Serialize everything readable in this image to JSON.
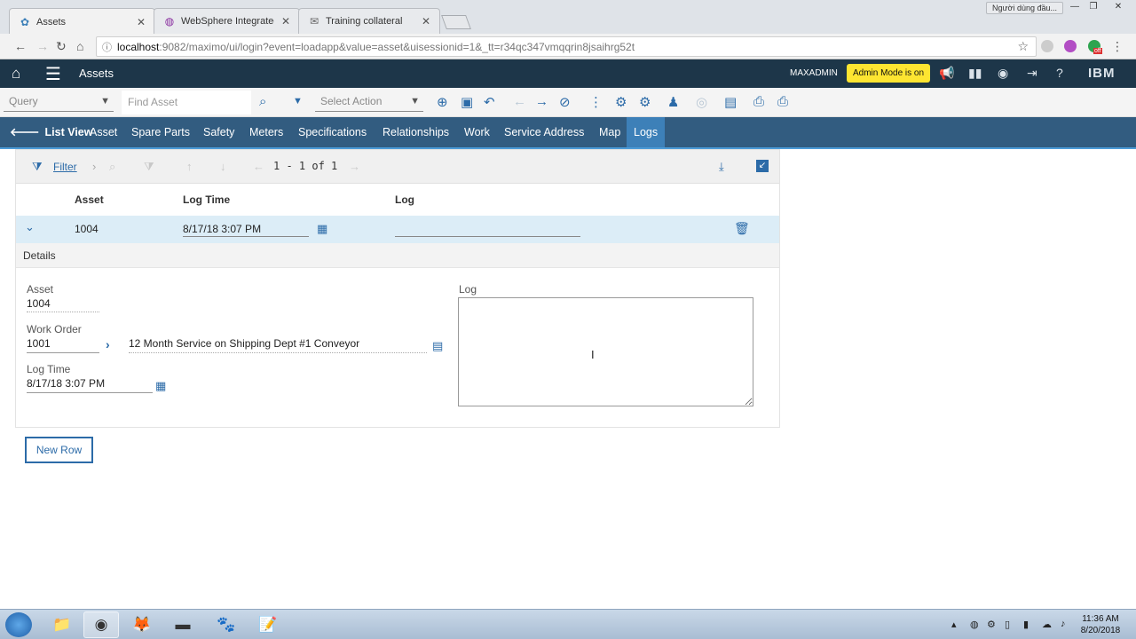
{
  "browser": {
    "tabs": [
      {
        "title": "Assets",
        "favicon": "asset-icon",
        "active": true
      },
      {
        "title": "WebSphere Integrated S",
        "favicon": "globe-icon",
        "active": false
      },
      {
        "title": "Training collateral",
        "favicon": "mail-icon",
        "active": false
      }
    ],
    "user_chip": "Người dùng đầu...",
    "url_host": "localhost",
    "url_path": ":9082/maximo/ui/login?event=loadapp&value=asset&uisessionid=1&_tt=r34qc347vmqqrin8jsaihrg52t",
    "extension_badge": "off"
  },
  "header": {
    "app_title": "Assets",
    "user": "MAXADMIN",
    "admin_badge": "Admin Mode is on",
    "brand": "IBM"
  },
  "toolbar": {
    "query_placeholder": "Query",
    "find_placeholder": "Find Asset",
    "action_placeholder": "Select Action"
  },
  "tabs": [
    {
      "label": "List View"
    },
    {
      "label": "Asset"
    },
    {
      "label": "Spare Parts"
    },
    {
      "label": "Safety"
    },
    {
      "label": "Meters"
    },
    {
      "label": "Specifications"
    },
    {
      "label": "Relationships"
    },
    {
      "label": "Work"
    },
    {
      "label": "Service Address"
    },
    {
      "label": "Map"
    },
    {
      "label": "Logs",
      "active": true
    }
  ],
  "table": {
    "filter_label": "Filter",
    "pager": "1 - 1 of 1",
    "columns": [
      "Asset",
      "Log Time",
      "Log"
    ],
    "rows": [
      {
        "asset": "1004",
        "log_time": "8/17/18 3:07 PM",
        "log": ""
      }
    ]
  },
  "details": {
    "header": "Details",
    "asset_label": "Asset",
    "asset_value": "1004",
    "workorder_label": "Work Order",
    "workorder_value": "1001",
    "workorder_desc": "12 Month Service on Shipping Dept #1 Conveyor",
    "logtime_label": "Log Time",
    "logtime_value": "8/17/18 3:07 PM",
    "log_label": "Log",
    "log_value": ""
  },
  "new_row_label": "New Row",
  "taskbar": {
    "time": "11:36 AM",
    "date": "8/20/2018"
  }
}
